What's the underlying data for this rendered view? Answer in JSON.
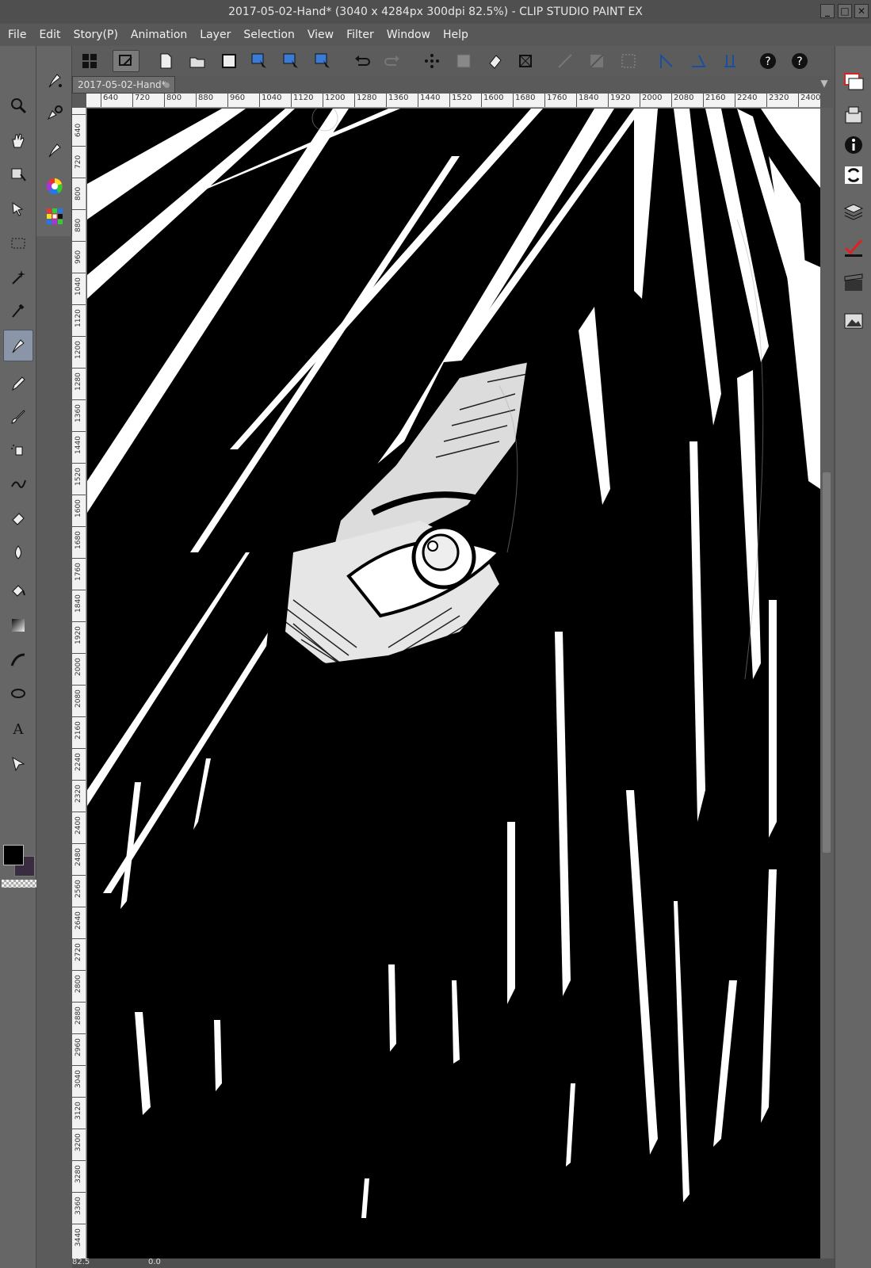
{
  "window": {
    "title": "2017-05-02-Hand* (3040 x 4284px 300dpi 82.5%)  - CLIP STUDIO PAINT EX",
    "controls": [
      "minimize",
      "maximize",
      "close"
    ]
  },
  "menu": [
    "File",
    "Edit",
    "Story(P)",
    "Animation",
    "Layer",
    "Selection",
    "View",
    "Filter",
    "Window",
    "Help"
  ],
  "document_tab": {
    "label": "2017-05-02-Hand*"
  },
  "ruler": {
    "horizontal": [
      "640",
      "720",
      "800",
      "880",
      "960",
      "1040",
      "1120",
      "1200",
      "1280",
      "1360",
      "1440",
      "1520",
      "1600",
      "1680",
      "1760",
      "1840",
      "1920",
      "2000",
      "2080",
      "2160",
      "2240",
      "2320",
      "2400"
    ],
    "vertical": [
      "640",
      "720",
      "800",
      "880",
      "960",
      "1040",
      "1120",
      "1200",
      "1280",
      "1360",
      "1440",
      "1520",
      "1600",
      "1680",
      "1760",
      "1840",
      "1920",
      "2000",
      "2080",
      "2160",
      "2240",
      "2320",
      "2400",
      "2480",
      "2560",
      "2640",
      "2720",
      "2800",
      "2880",
      "2960",
      "3040",
      "3120",
      "3200",
      "3280",
      "3360",
      "3440"
    ]
  },
  "status": {
    "zoom": "82.5",
    "angle": "0.0"
  },
  "colors": {
    "main": "#000000",
    "sub": "#3a2c40",
    "accent": "#8a96a8"
  },
  "tools": [
    "zoom-icon",
    "hand-icon",
    "move-layer-icon",
    "operation-icon",
    "selection-icon",
    "magic-wand-icon",
    "eyedropper-icon",
    "pen-icon",
    "pencil-icon",
    "brush-icon",
    "airbrush-icon",
    "decoration-icon",
    "eraser-icon",
    "blend-icon",
    "fill-icon",
    "gradient-icon",
    "figure-icon",
    "ellipse-icon",
    "text-icon",
    "balloon-icon"
  ],
  "right_palette": [
    "layer-property-icon",
    "sub-view-icon",
    "info-icon",
    "history-icon",
    "layer-icon",
    "auto-action-icon",
    "animation-icon",
    "material-icon"
  ]
}
